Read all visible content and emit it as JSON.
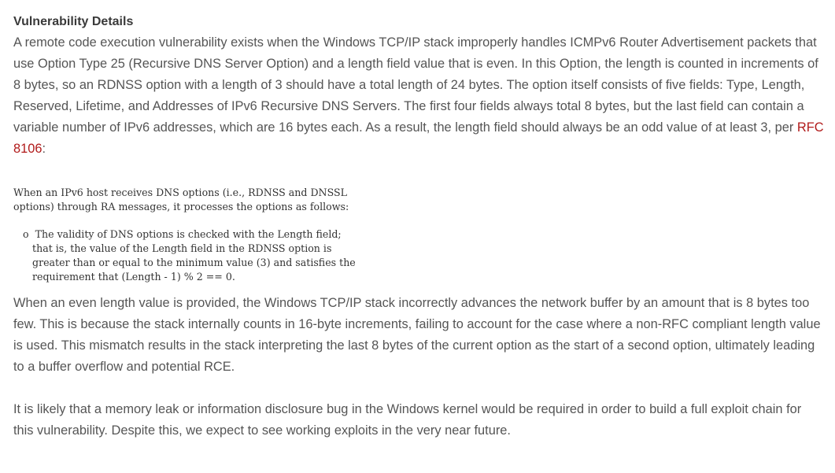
{
  "heading": "Vulnerability Details",
  "paragraph1": {
    "text_before_link": "A remote code execution vulnerability exists when the Windows TCP/IP stack improperly handles ICMPv6 Router Advertisement packets that use Option Type 25 (Recursive DNS Server Option) and a length field value that is even. In this Option, the length is counted in increments of 8 bytes, so an RDNSS option with a length of 3 should have a total length of 24 bytes. The option itself consists of five fields: Type, Length, Reserved, Lifetime, and Addresses of IPv6 Recursive DNS Servers. The first four fields always total 8 bytes, but the last field can contain a variable number of IPv6 addresses, which are 16 bytes each. As a result, the length field should always be an odd value of at least 3, per ",
    "link_text": "RFC 8106",
    "text_after_link": ":"
  },
  "quote_intro": "When an IPv6 host receives DNS options (i.e., RDNSS and DNSSL\noptions) through RA messages, it processes the options as follows:",
  "quote_bullet": "   o  The validity of DNS options is checked with the Length field;\n      that is, the value of the Length field in the RDNSS option is\n      greater than or equal to the minimum value (3) and satisfies the\n      requirement that (Length - 1) % 2 == 0.",
  "paragraph2": "When an even length value is provided, the Windows TCP/IP stack incorrectly advances the network buffer by an amount that is 8 bytes too few. This is because the stack internally counts in 16-byte increments, failing to account for the case where a non-RFC compliant length value is used. This mismatch results in the stack interpreting the last 8 bytes of the current option as the start of a second option, ultimately leading to a buffer overflow and potential RCE.",
  "paragraph3": "It is likely that a memory leak or information disclosure bug in the Windows kernel would be required in order to build a full exploit chain for this vulnerability. Despite this, we expect to see working exploits in the very near future.",
  "colors": {
    "body_text": "#555555",
    "heading_text": "#3a3a3a",
    "link": "#b11a1a",
    "code_text": "#333333"
  }
}
